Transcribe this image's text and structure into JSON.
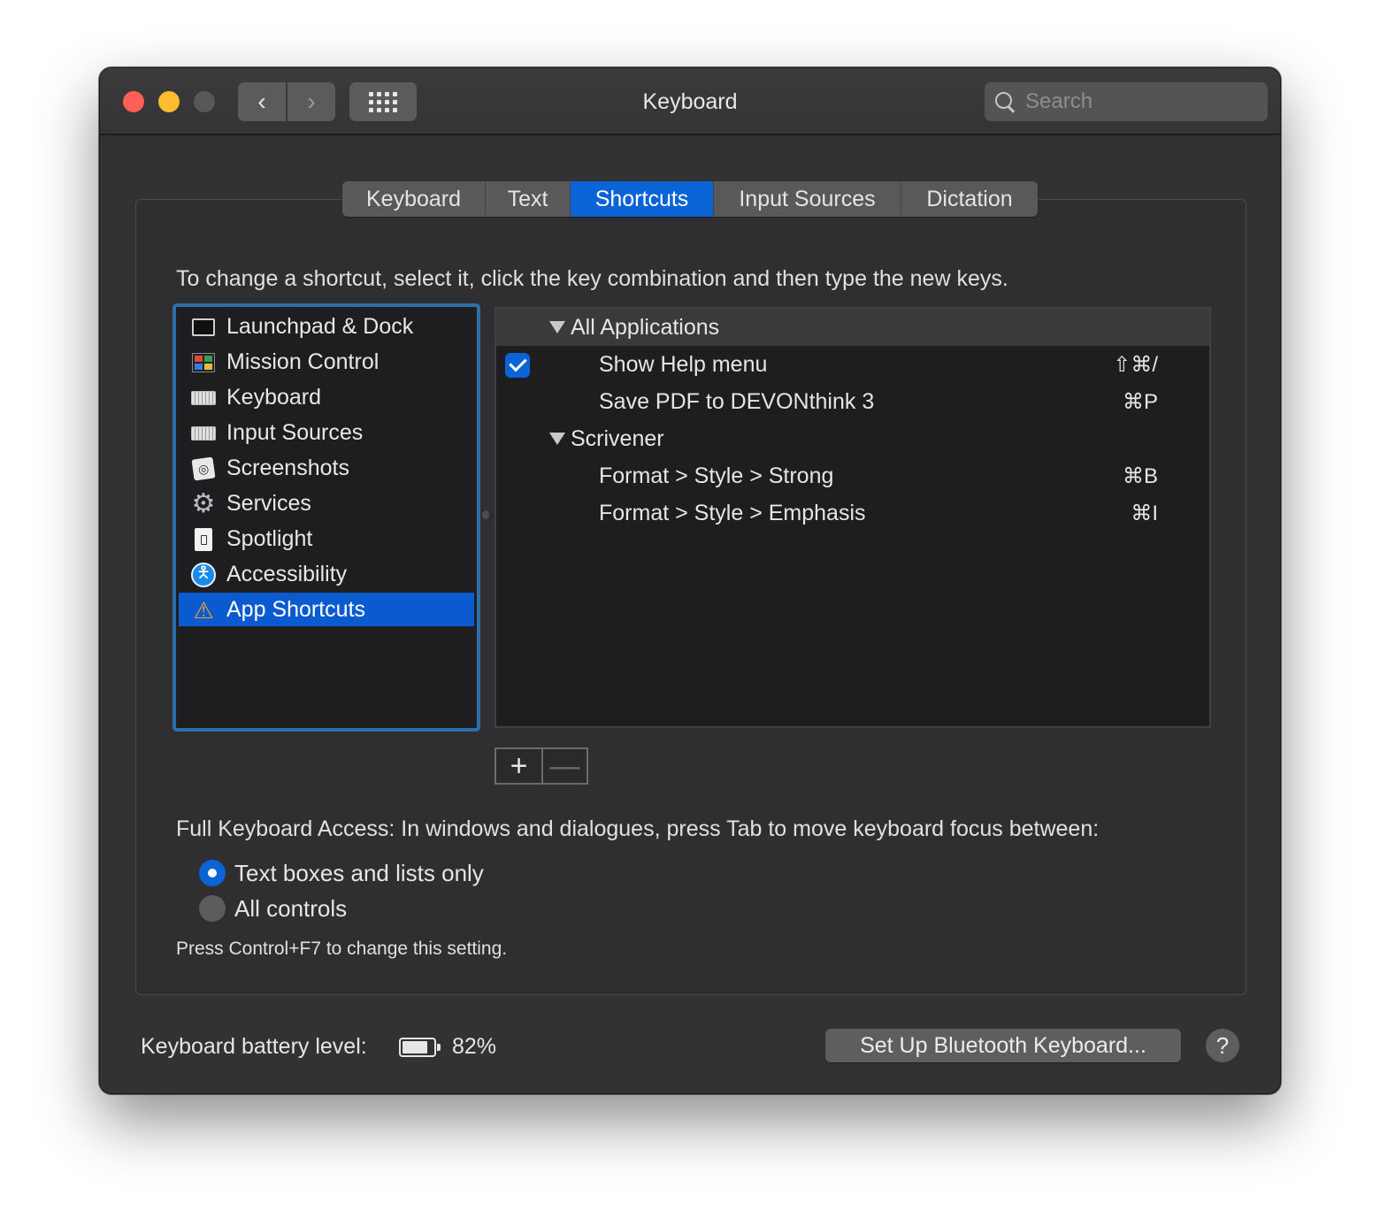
{
  "window": {
    "title": "Keyboard"
  },
  "toolbar": {
    "search_placeholder": "Search"
  },
  "tabs": [
    {
      "label": "Keyboard",
      "active": false
    },
    {
      "label": "Text",
      "active": false
    },
    {
      "label": "Shortcuts",
      "active": true
    },
    {
      "label": "Input Sources",
      "active": false
    },
    {
      "label": "Dictation",
      "active": false
    }
  ],
  "instructions": "To change a shortcut, select it, click the key combination and then type the new keys.",
  "categories": [
    {
      "label": "Launchpad & Dock",
      "icon": "launchpad-dock-icon"
    },
    {
      "label": "Mission Control",
      "icon": "mission-control-icon"
    },
    {
      "label": "Keyboard",
      "icon": "keyboard-icon"
    },
    {
      "label": "Input Sources",
      "icon": "input-sources-icon"
    },
    {
      "label": "Screenshots",
      "icon": "screenshots-icon"
    },
    {
      "label": "Services",
      "icon": "gear-icon"
    },
    {
      "label": "Spotlight",
      "icon": "document-icon"
    },
    {
      "label": "Accessibility",
      "icon": "accessibility-icon"
    },
    {
      "label": "App Shortcuts",
      "icon": "app-store-icon",
      "selected": true
    }
  ],
  "shortcuts": {
    "group_all": "All Applications",
    "show_help": {
      "label": "Show Help menu",
      "keys": "⇧⌘/",
      "checked": true
    },
    "save_pdf": {
      "label": "Save PDF to DEVONthink 3",
      "keys": "⌘P"
    },
    "group_scrivener": "Scrivener",
    "strong": {
      "label": "Format > Style > Strong",
      "keys": "⌘B"
    },
    "emphasis": {
      "label": "Format > Style > Emphasis",
      "keys": "⌘I"
    }
  },
  "add_remove": {
    "add": "+",
    "remove": "—"
  },
  "full_keyboard_access": {
    "text": "Full Keyboard Access: In windows and dialogues, press Tab to move keyboard focus between:",
    "option_text_boxes": "Text boxes and lists only",
    "option_all_controls": "All controls",
    "selected": "text_boxes",
    "hint": "Press Control+F7 to change this setting."
  },
  "footer": {
    "battery_label": "Keyboard battery level:",
    "battery_level": 0.82,
    "battery_percent": "82%",
    "bluetooth_button": "Set Up Bluetooth Keyboard...",
    "help": "?"
  },
  "colors": {
    "accent": "#0a64d6",
    "selection": "#0a5bd0"
  }
}
